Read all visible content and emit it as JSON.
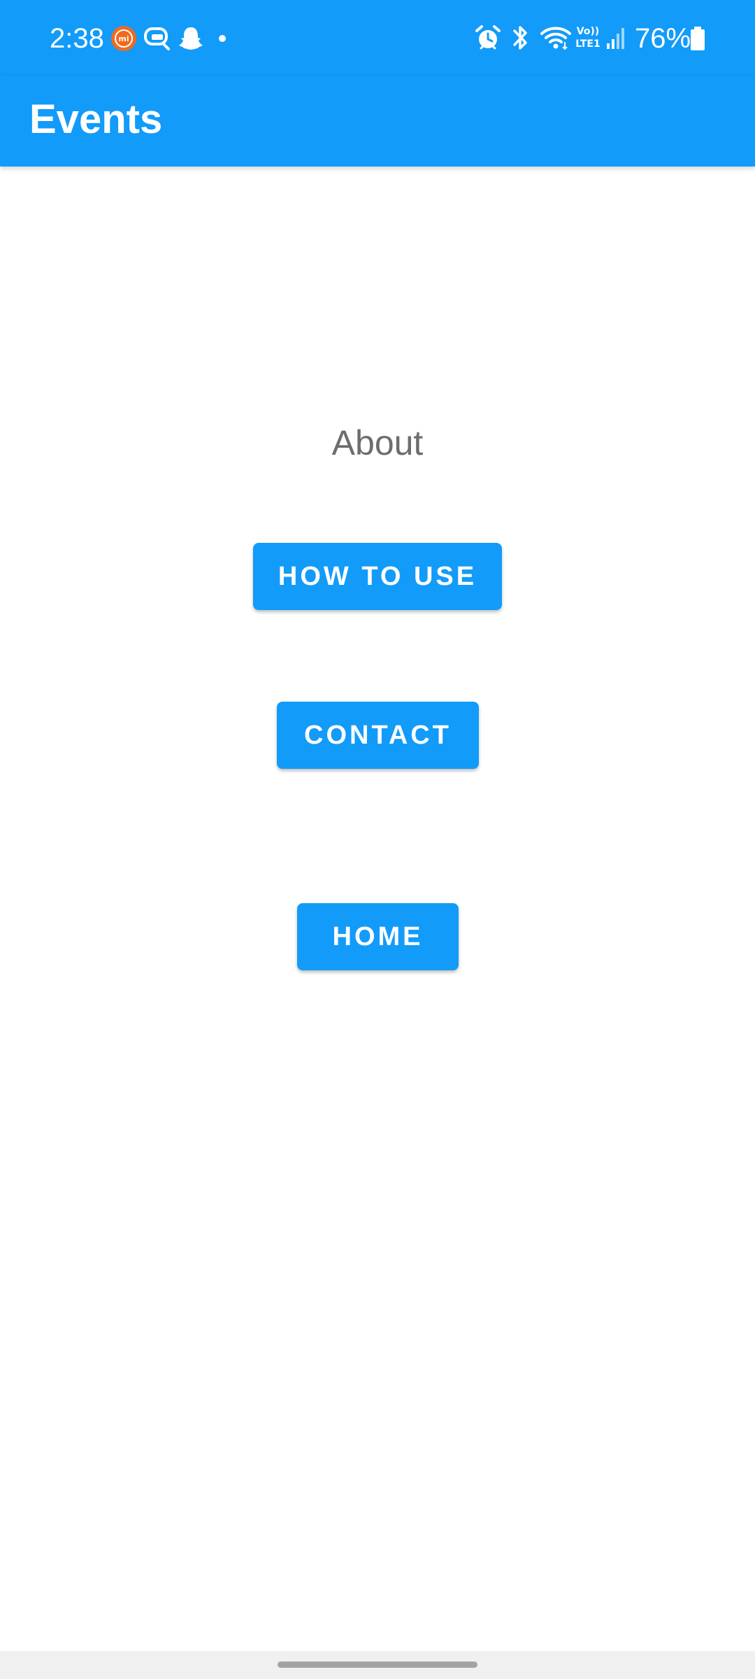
{
  "status_bar": {
    "time": "2:38",
    "battery_percent": "76%",
    "background_color": "#129bf9",
    "left_icons": [
      "mi-app-icon",
      "chat-bubble-icon",
      "snapchat-ghost-icon",
      "notification-dot-icon"
    ],
    "right_icons": [
      "alarm-icon",
      "bluetooth-icon",
      "wifi-icon",
      "volte-lte-icon",
      "signal-icon",
      "battery-icon"
    ],
    "volte_text": "Vo))",
    "lte_text": "LTE1"
  },
  "app_bar": {
    "title": "Events"
  },
  "content": {
    "heading": "About",
    "buttons": {
      "how_to_use": "HOW TO USE",
      "contact": "CONTACT",
      "home": "HOME"
    }
  },
  "colors": {
    "accent": "#129bf9",
    "heading_text": "#6d6d6d",
    "background": "#ffffff"
  }
}
